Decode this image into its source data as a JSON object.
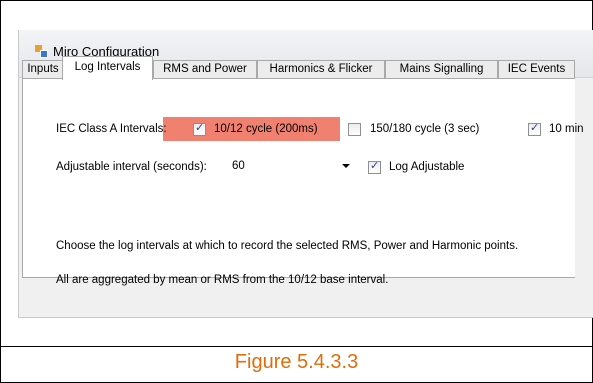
{
  "window": {
    "title": "Miro Configuration",
    "icon": "app-icon"
  },
  "tabs": [
    {
      "label": "Inputs",
      "active": false
    },
    {
      "label": "Log Intervals",
      "active": true
    },
    {
      "label": "RMS and Power",
      "active": false
    },
    {
      "label": "Harmonics & Flicker",
      "active": false
    },
    {
      "label": "Mains Signalling",
      "active": false
    },
    {
      "label": "IEC Events",
      "active": false
    }
  ],
  "log_intervals": {
    "iec_label": "IEC Class A Intervals:",
    "opt_10_12": {
      "label": "10/12 cycle (200ms)",
      "checked": true,
      "highlight_color": "#f08070"
    },
    "opt_150_180": {
      "label": "150/180 cycle (3 sec)",
      "checked": false
    },
    "opt_10min": {
      "label": "10 min",
      "checked": true
    },
    "adjustable_label": "Adjustable interval (seconds):",
    "adjustable_value": "60",
    "log_adjustable": {
      "label": "Log Adjustable",
      "checked": true
    },
    "info_line1": "Choose the log intervals at which to record the selected RMS, Power and Harmonic points.",
    "info_line2": "All are aggregated by mean or RMS from the 10/12 base interval."
  },
  "caption": "Figure 5.4.3.3",
  "colors": {
    "caption": "#e36c0a",
    "check": "#2a3f9a"
  }
}
